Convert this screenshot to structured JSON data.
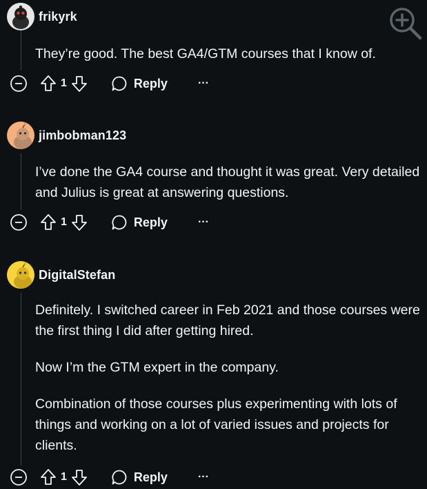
{
  "comments": [
    {
      "username": "frikyrk",
      "avatar_color": "#e6e6e6",
      "paragraphs": [
        "They’re good. The best GA4/GTM courses that I know of."
      ],
      "score": "1",
      "reply_label": "Reply",
      "more_label": "···"
    },
    {
      "username": "jimbobman123",
      "avatar_color": "#f5b07d",
      "paragraphs": [
        "I’ve done the GA4 course and thought it was great. Very detailed and Julius is great at answering questions."
      ],
      "score": "1",
      "reply_label": "Reply",
      "more_label": "···"
    },
    {
      "username": "DigitalStefan",
      "avatar_color": "#f7d43b",
      "paragraphs": [
        "Definitely. I switched career in Feb 2021 and those courses were the first thing I did after getting hired.",
        "Now I’m the GTM expert in the company.",
        "Combination of those courses plus experimenting with lots of things and working on a lot of varied issues and projects for clients."
      ],
      "score": "1",
      "reply_label": "Reply",
      "more_label": "···"
    }
  ],
  "icons": {
    "collapse": "minus-circle-icon",
    "upvote": "upvote-arrow-icon",
    "downvote": "downvote-arrow-icon",
    "reply": "speech-bubble-icon",
    "zoom": "zoom-in-icon"
  },
  "colors": {
    "background": "#0e1113",
    "text": "#f2f4f5",
    "thread_line": "#3c4245"
  }
}
